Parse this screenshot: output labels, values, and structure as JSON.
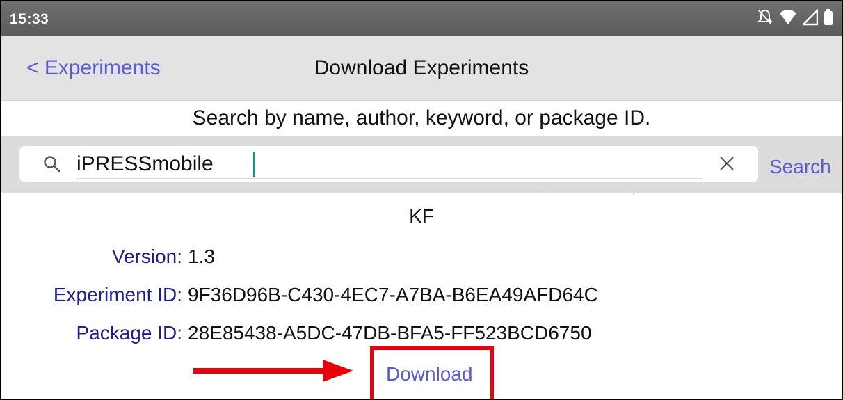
{
  "status_bar": {
    "time": "15:33",
    "icons": [
      "notifications-off-icon",
      "wifi-icon",
      "signal-icon",
      "battery-icon"
    ]
  },
  "nav": {
    "back_label": "< Experiments",
    "title": "Download Experiments"
  },
  "search": {
    "hint": "Search by name, author, keyword, or package ID.",
    "value": "iPRESSmobile",
    "button_label": "Search",
    "icons": [
      "search-icon",
      "clear-icon"
    ]
  },
  "result": {
    "title": "KF",
    "version_label": "Version:",
    "version": "1.3",
    "experiment_id_label": "Experiment ID:",
    "experiment_id": "9F36D96B-C430-4EC7-A7BA-B6EA49AFD64C",
    "package_id_label": "Package ID:",
    "package_id": "28E85438-A5DC-47DB-BFA5-FF523BCD6750",
    "download_label": "Download"
  },
  "colors": {
    "link": "#5b5bd6",
    "label": "#1f1f8a",
    "annotation": "#e8000b"
  }
}
